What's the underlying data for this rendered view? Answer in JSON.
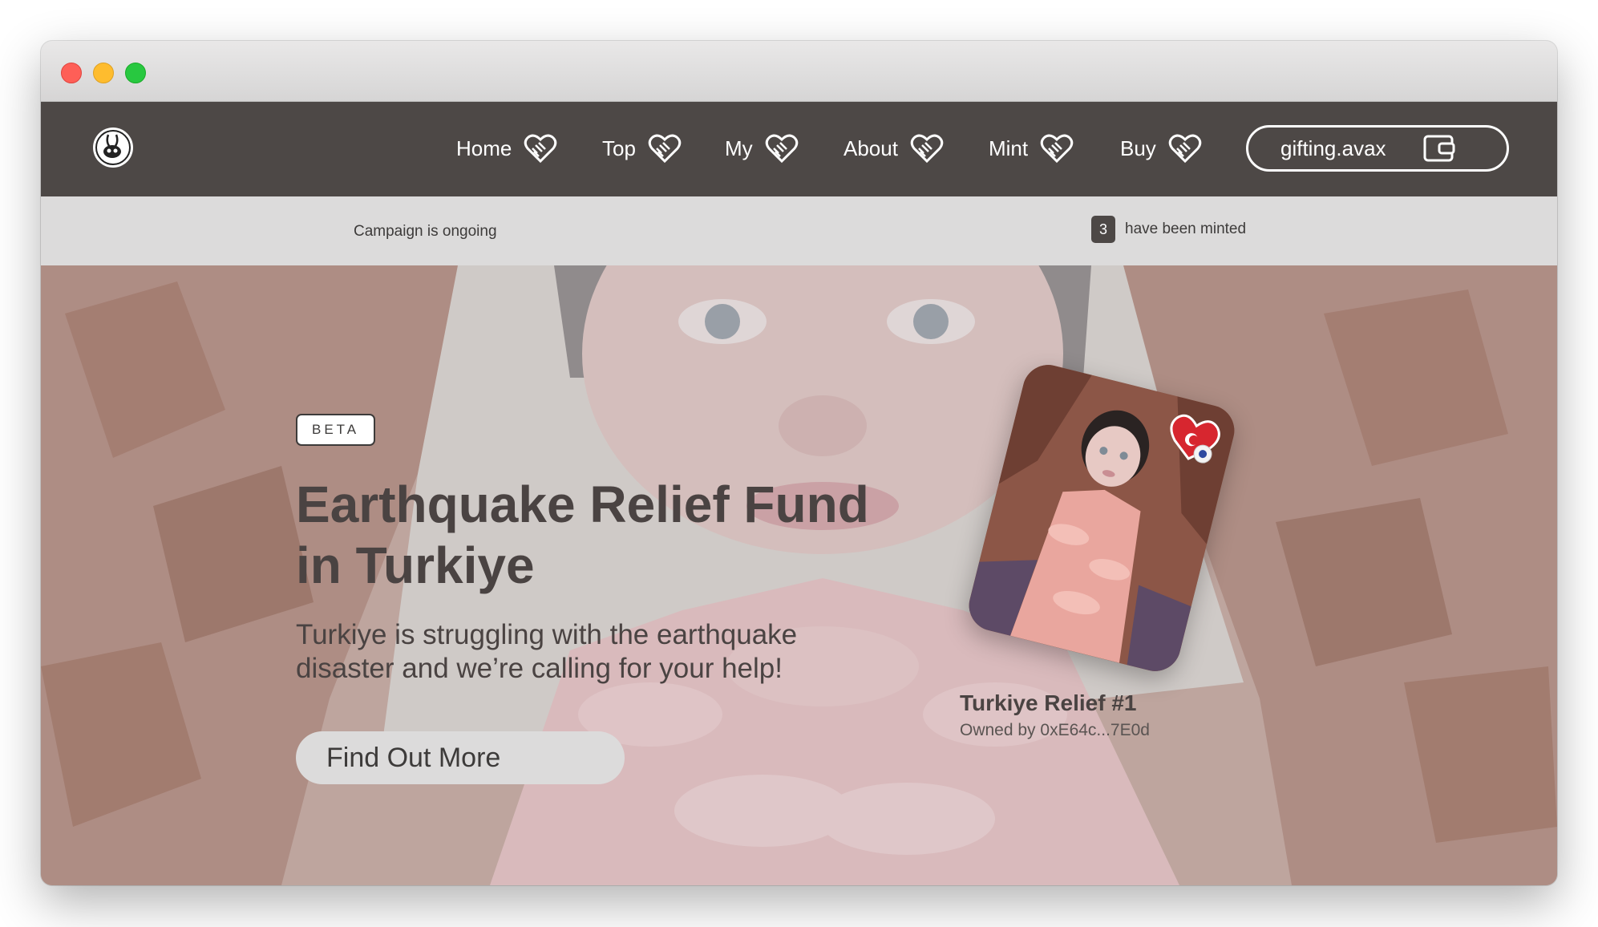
{
  "nav": {
    "items": [
      {
        "label": "Home",
        "icon": "heart-handshake-icon"
      },
      {
        "label": "Top",
        "icon": "heart-handshake-icon"
      },
      {
        "label": "My",
        "icon": "heart-handshake-icon"
      },
      {
        "label": "About",
        "icon": "heart-handshake-icon"
      },
      {
        "label": "Mint",
        "icon": "heart-handshake-icon"
      },
      {
        "label": "Buy",
        "icon": "heart-handshake-icon"
      }
    ],
    "wallet_label": "gifting.avax",
    "wallet_icon": "wallet-icon",
    "logo_icon": "bunny-logo-icon"
  },
  "status": {
    "campaign": "Campaign is ongoing",
    "minted_count": "3",
    "minted_label": "have been minted"
  },
  "hero": {
    "badge": "BETA",
    "title": "Earthquake Relief Fund in Turkiye",
    "subtitle": "Turkiye is struggling with the earthquake disaster and we’re calling for your help!",
    "cta_label": "Find Out More"
  },
  "nft": {
    "name": "Turkiye Relief #1",
    "owner": "Owned by 0xE64c...7E0d"
  },
  "colors": {
    "navbar": "#4d4846",
    "statusbar": "#dcdbdb",
    "text_dark": "#4a4342"
  }
}
